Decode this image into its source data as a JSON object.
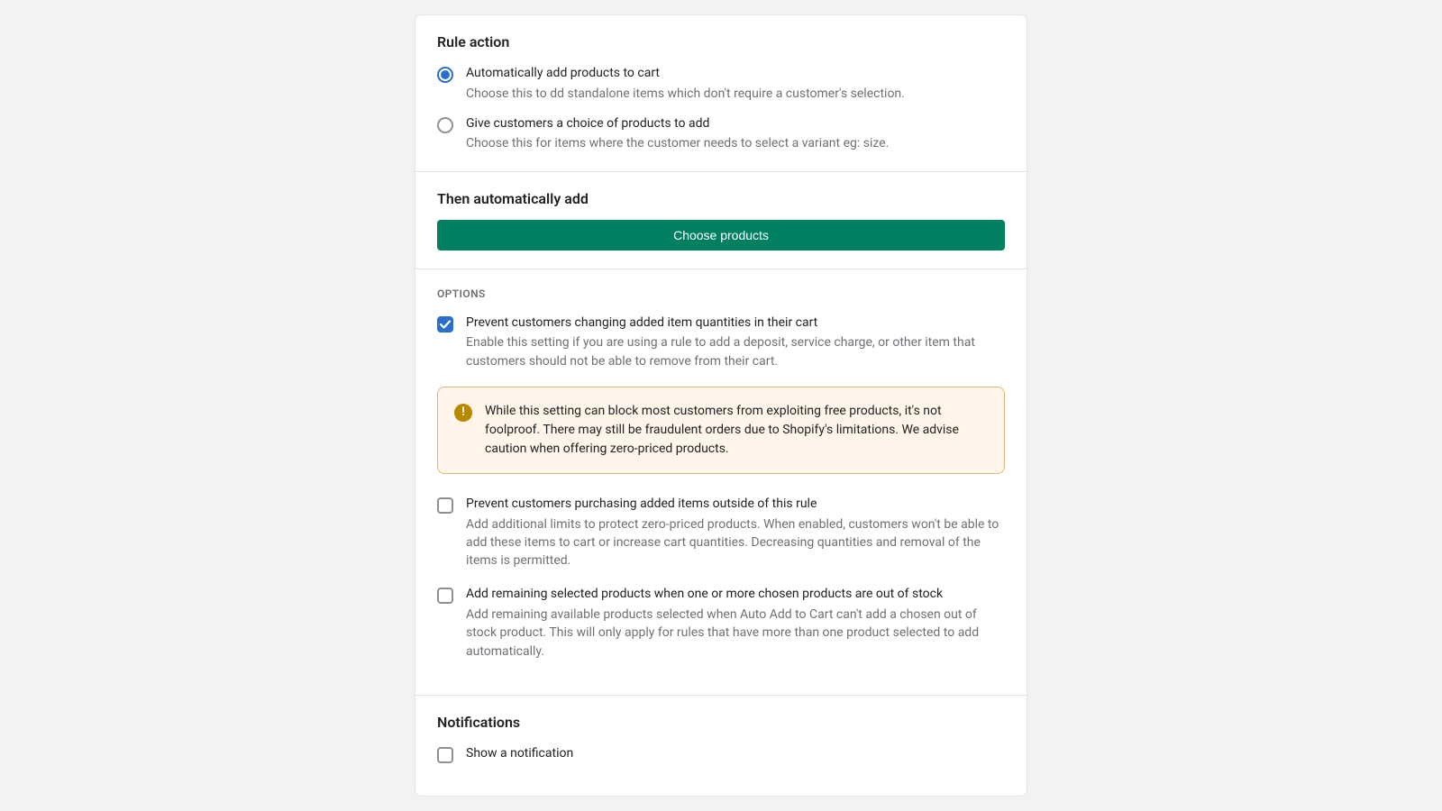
{
  "rule_action": {
    "title": "Rule action",
    "options": [
      {
        "label": "Automatically add products to cart",
        "desc": "Choose this to dd standalone items which don't require a customer's selection.",
        "selected": true
      },
      {
        "label": "Give customers a choice of products to add",
        "desc": "Choose this for items where the customer needs to select a variant eg: size.",
        "selected": false
      }
    ]
  },
  "then": {
    "title": "Then automatically add",
    "button": "Choose products"
  },
  "options": {
    "label": "OPTIONS",
    "items": [
      {
        "label": "Prevent customers changing added item quantities in their cart",
        "desc": "Enable this setting if you are using a rule to add a deposit, service charge, or other item that customers should not be able to remove from their cart.",
        "checked": true
      },
      {
        "label": "Prevent customers purchasing added items outside of this rule",
        "desc": "Add additional limits to protect zero-priced products. When enabled, customers won't be able to add these items to cart or increase cart quantities. Decreasing quantities and removal of the items is permitted.",
        "checked": false
      },
      {
        "label": "Add remaining selected products when one or more chosen products are out of stock",
        "desc": "Add remaining available products selected when Auto Add to Cart can't add a chosen out of stock product. This will only apply for rules that have more than one product selected to add automatically.",
        "checked": false
      }
    ],
    "banner": "While this setting can block most customers from exploiting free products, it's not foolproof. There may still be fraudulent orders due to Shopify's limitations. We advise caution when offering zero-priced products."
  },
  "notifications": {
    "title": "Notifications",
    "items": [
      {
        "label": "Show a notification",
        "checked": false
      }
    ]
  }
}
